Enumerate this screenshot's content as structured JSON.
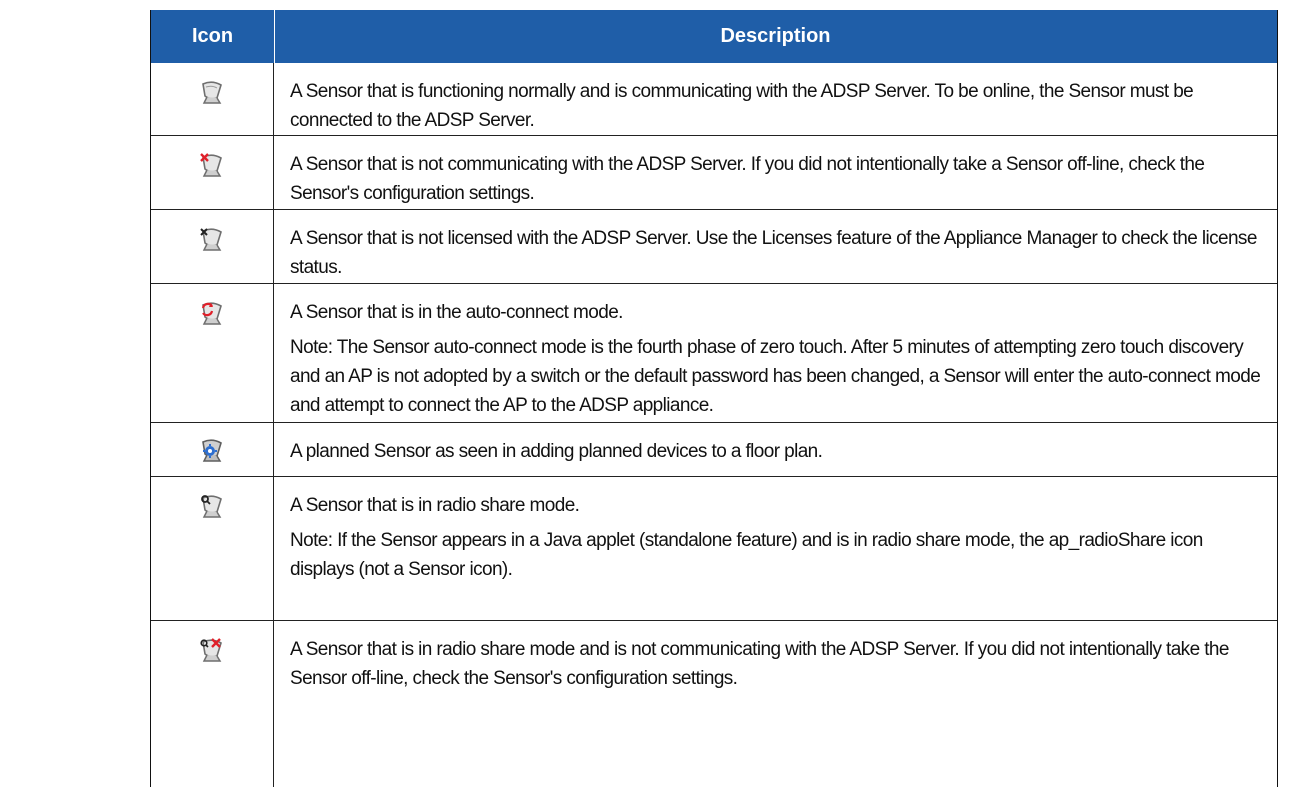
{
  "table": {
    "header_icon": "Icon",
    "header_description": "Description",
    "rows": [
      {
        "icon": "sensor-online-icon",
        "lines": [
          "A Sensor that is functioning normally and is communicating with the ADSP Server. To be online, the Sensor must be connected to the ADSP Server."
        ]
      },
      {
        "icon": "sensor-offline-icon",
        "lines": [
          "A Sensor that is not communicating with the ADSP Server. If you did not intentionally take a Sensor off-line, check the Sensor's configuration settings."
        ]
      },
      {
        "icon": "sensor-unlicensed-icon",
        "lines": [
          "A Sensor that is not licensed with the ADSP Server. Use the Licenses feature of the Appliance Manager to check the license status."
        ]
      },
      {
        "icon": "sensor-auto-connect-icon",
        "lines": [
          "A Sensor that is in the auto-connect mode.",
          "Note: The Sensor auto-connect mode is the fourth phase of zero touch. After 5 minutes of attempting zero touch discovery and an AP is not adopted by a switch or the default password has been changed, a Sensor will enter the auto-connect mode and attempt to connect the AP to the ADSP appliance."
        ]
      },
      {
        "icon": "sensor-planned-icon",
        "lines": [
          "A planned Sensor as seen in adding planned devices to a floor plan."
        ]
      },
      {
        "icon": "sensor-radio-share-icon",
        "lines": [
          "A Sensor that is in radio share mode.",
          "Note: If the Sensor appears in a Java applet (standalone feature) and is in radio share mode, the ap_radioShare icon displays (not a Sensor icon)."
        ]
      },
      {
        "icon": "sensor-radio-share-offline-icon",
        "lines": [
          "A Sensor that is in radio share mode and is not communicating with the ADSP Server. If you did not intentionally take the Sensor off-line, check the Sensor's configuration settings."
        ]
      }
    ]
  },
  "colors": {
    "header_bg": "#1f5ea8",
    "header_text": "#ffffff",
    "alert_red": "#e0202a",
    "planned_blue": "#2e6fd0"
  }
}
